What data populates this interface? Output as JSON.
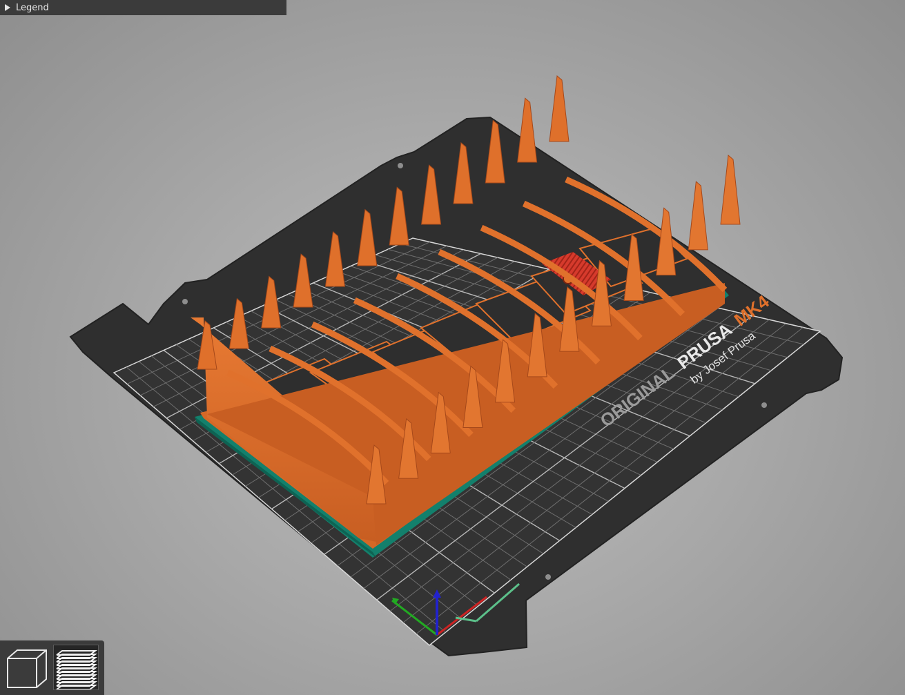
{
  "legend": {
    "label": "Legend",
    "arrow_icon": "triangle-right-icon",
    "expanded": false
  },
  "bed": {
    "logo_original": "ORIGINAL",
    "logo_prusa": "PRUSA",
    "logo_model": "MK4",
    "logo_byline": "by Josef Prusa",
    "bed_color": "#353535",
    "grid_color": "#7a7a7a"
  },
  "model": {
    "wall_color": "#e0712c",
    "wall_shade_color": "#b85520",
    "brim_color": "#13806c",
    "support_color": "#d63a2c"
  },
  "axes": {
    "x_color": "#cc2222",
    "y_color": "#22aa22",
    "z_color": "#2222cc"
  },
  "toolbar": {
    "buttons": [
      {
        "name": "3d-view-button",
        "icon": "cube-icon",
        "selected": false
      },
      {
        "name": "preview-button",
        "icon": "layers-icon",
        "selected": true
      }
    ]
  }
}
